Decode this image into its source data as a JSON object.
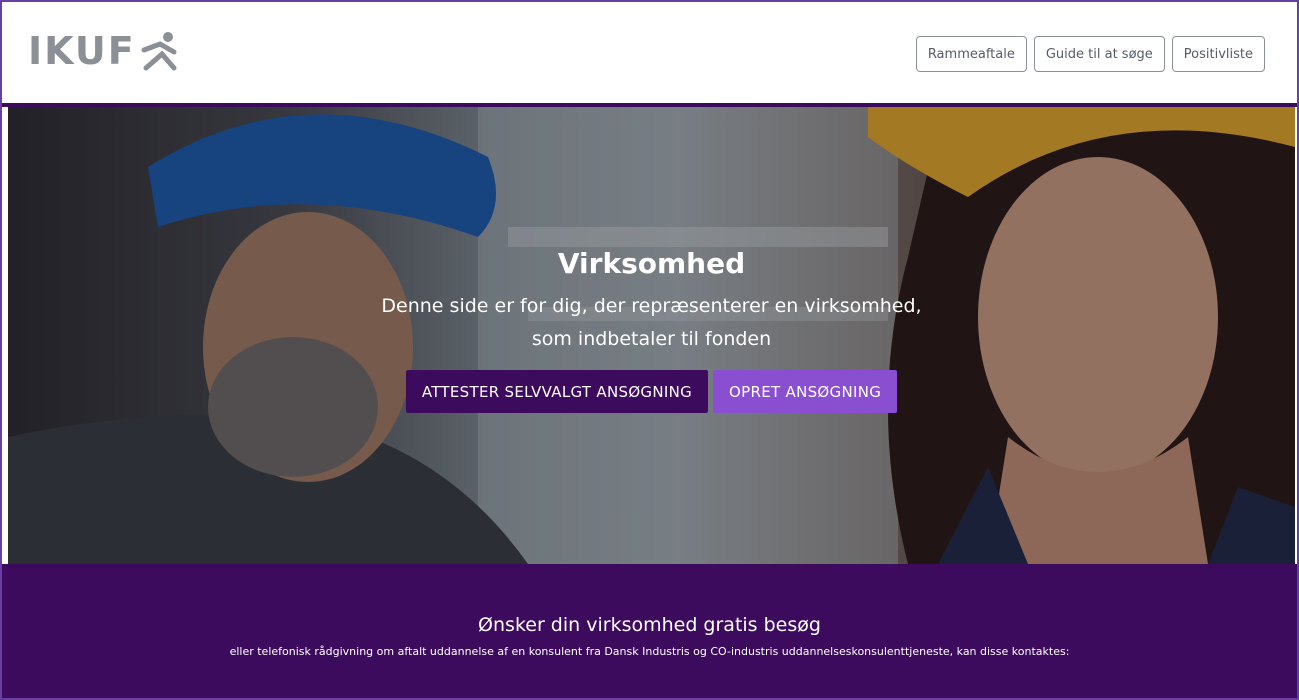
{
  "header": {
    "logo_text": "IKUF",
    "nav": [
      "Rammeaftale",
      "Guide til at søge",
      "Positivliste"
    ]
  },
  "hero": {
    "title": "Virksomhed",
    "subtitle_line1": "Denne side er for dig, der repræsenterer en virksomhed,",
    "subtitle_line2": "som indbetaler til fonden",
    "btn_attest": "ATTESTER SELVVALGT ANSØGNING",
    "btn_create": "OPRET ANSØGNING"
  },
  "band": {
    "title": "Ønsker din virksomhed gratis besøg",
    "text": "eller telefonisk rådgivning om aftalt uddannelse af en konsulent fra Dansk Industris og CO-industris uddannelseskonsulenttjeneste, kan disse kontaktes:"
  },
  "colors": {
    "brand_purple": "#3d0b5e",
    "accent_purple": "#8a4fd0",
    "logo_gray": "#8b8f96"
  }
}
